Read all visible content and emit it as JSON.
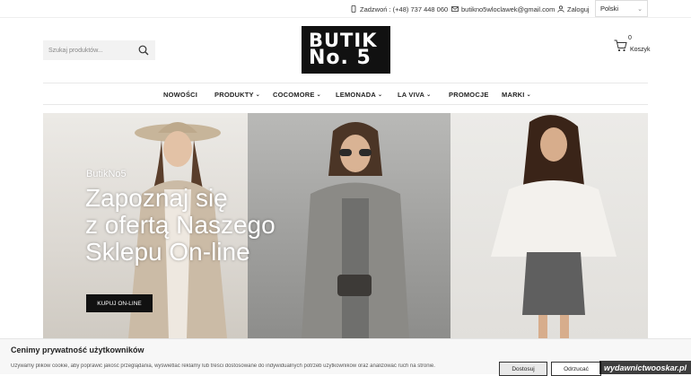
{
  "topbar": {
    "phone": "Zadzwoń : (+48) 737 448 060",
    "email": "butikno5wloclawek@gmail.com",
    "login": "Zaloguj",
    "language": "Polski"
  },
  "search": {
    "placeholder": "Szukaj produktów..."
  },
  "logo": {
    "line1": "BUTIK",
    "line2": "No. 5"
  },
  "cart": {
    "count": "0",
    "label": "Koszyk"
  },
  "nav": {
    "items": [
      {
        "label": "NOWOŚCI",
        "dropdown": false
      },
      {
        "label": "PRODUKTY",
        "dropdown": true
      },
      {
        "label": "COCOMORE",
        "dropdown": true
      },
      {
        "label": "LEMONADA",
        "dropdown": true
      },
      {
        "label": "LA VIVA",
        "dropdown": true
      },
      {
        "label": "PROMOCJE",
        "dropdown": false
      },
      {
        "label": "MARKI",
        "dropdown": true
      }
    ]
  },
  "hero": {
    "subtitle": "ButikNo5",
    "title_line1": "Zapoznaj się",
    "title_line2": "z ofertą Naszego",
    "title_line3": "Sklepu On-line",
    "button": "KUPUJ ON-LINE"
  },
  "cookie": {
    "title": "Cenimy prywatność użytkowników",
    "text": "Używamy plików cookie, aby poprawić jakość przeglądania, wyświetlać reklamy lub treści dostosowane do indywidualnych potrzeb użytkowników oraz analizować ruch na stronie.",
    "accept": "Dostosuj",
    "reject": "Odrzucać"
  },
  "watermark": "wydawnictwooskar.pl",
  "colors": {
    "accent": "#111111",
    "hero_text": "#ffffff"
  }
}
